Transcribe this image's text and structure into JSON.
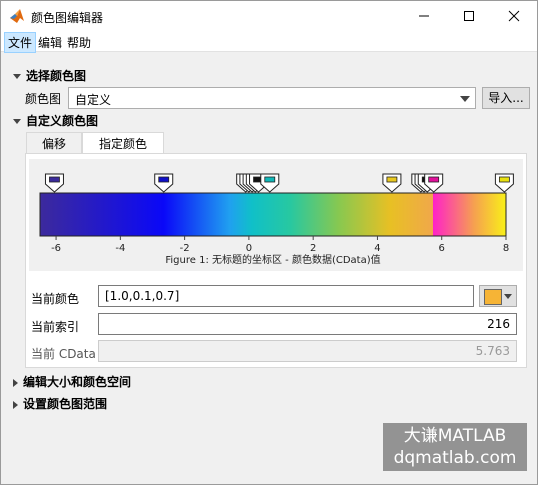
{
  "window": {
    "title": "颜色图编辑器",
    "controls": [
      "minimize-icon",
      "maximize-icon",
      "close-icon"
    ]
  },
  "menu": [
    "文件",
    "编辑",
    "帮助"
  ],
  "sections": {
    "select": "选择颜色图",
    "custom": "自定义颜色图",
    "resize": "编辑大小和颜色空间",
    "range": "设置颜色图范围"
  },
  "colormap": {
    "label": "颜色图",
    "value": "自定义",
    "import_button": "导入..."
  },
  "tabs": [
    "偏移",
    "指定颜色"
  ],
  "chart_data": {
    "type": "heatmap",
    "title": "Figure 1: 无标题的坐标区 - 颜色数据(CData)值",
    "xlim": [
      -6.5,
      8
    ],
    "ticks": [
      -6,
      -4,
      -2,
      0,
      2,
      4,
      6,
      8
    ],
    "markers": [
      {
        "x": -6.05,
        "color": "#3a2a9a"
      },
      {
        "x": -2.65,
        "color": "#1010c8"
      },
      {
        "x": -0.1,
        "color": "#111111"
      },
      {
        "x": 0.0,
        "color": "#111111"
      },
      {
        "x": 0.1,
        "color": "#111111"
      },
      {
        "x": 0.2,
        "color": "#111111"
      },
      {
        "x": 0.3,
        "color": "#111111"
      },
      {
        "x": 0.65,
        "color": "#10b8b8"
      },
      {
        "x": 4.45,
        "color": "#e8c820"
      },
      {
        "x": 5.35,
        "color": "#111111"
      },
      {
        "x": 5.45,
        "color": "#111111"
      },
      {
        "x": 5.55,
        "color": "#111111"
      },
      {
        "x": 5.75,
        "color": "#e0109a"
      },
      {
        "x": 7.95,
        "color": "#e8e010"
      }
    ],
    "gradient": [
      {
        "x": -6.5,
        "color": "#3c2a9c"
      },
      {
        "x": -2.65,
        "color": "#0a08f8"
      },
      {
        "x": -0.6,
        "color": "#20a0f0"
      },
      {
        "x": 0.1,
        "color": "#10c0c8"
      },
      {
        "x": 1.3,
        "color": "#28c8a0"
      },
      {
        "x": 2.8,
        "color": "#88c850"
      },
      {
        "x": 4.4,
        "color": "#e8c024"
      },
      {
        "x": 5.72,
        "color": "#f0a84a"
      },
      {
        "x": 5.73,
        "color": "#ff22c8"
      },
      {
        "x": 7.0,
        "color": "#f6a050"
      },
      {
        "x": 8.0,
        "color": "#f8f018"
      }
    ]
  },
  "current": {
    "color_label": "当前颜色",
    "color_value": "[1.0,0.1,0.7]",
    "swatch": "#f6b436",
    "index_label": "当前索引",
    "index_value": "216",
    "cdata_label": "当前 CData",
    "cdata_value": "5.763"
  },
  "watermark": {
    "line1": "大谦MATLAB",
    "line2": "dqmatlab.com"
  }
}
